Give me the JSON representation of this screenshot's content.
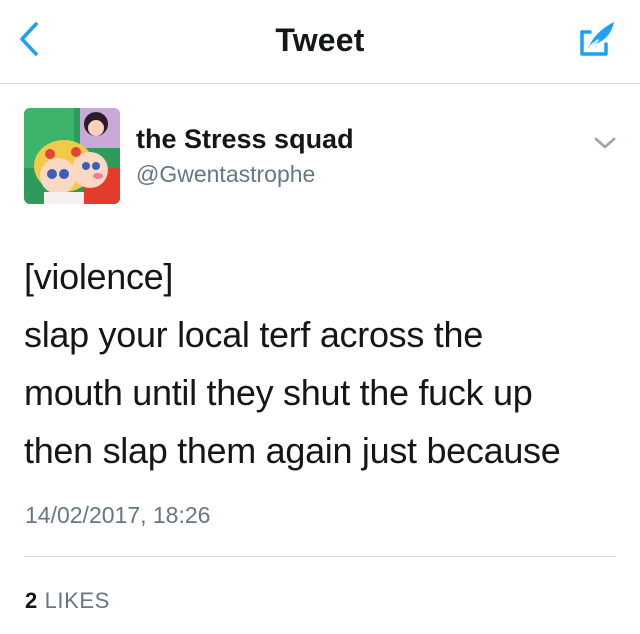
{
  "nav": {
    "title": "Tweet",
    "back_icon": "chevron-left-icon",
    "compose_icon": "compose-tweet-icon",
    "accent_color": "#1da1f2"
  },
  "author": {
    "display_name": "the Stress squad",
    "handle": "@Gwentastrophe",
    "avatar_icon": "anime-avatar-image",
    "menu_icon": "chevron-down-icon"
  },
  "tweet": {
    "lines": [
      "[violence]",
      "slap your local terf across the",
      "mouth until they shut the fuck up",
      "then slap them again just because"
    ],
    "timestamp": "14/02/2017, 18:26"
  },
  "stats": {
    "likes_count": "2",
    "likes_label": "LIKES"
  },
  "colors": {
    "text_primary": "#14171a",
    "text_secondary": "#657786",
    "divider": "#d4d6d9"
  }
}
